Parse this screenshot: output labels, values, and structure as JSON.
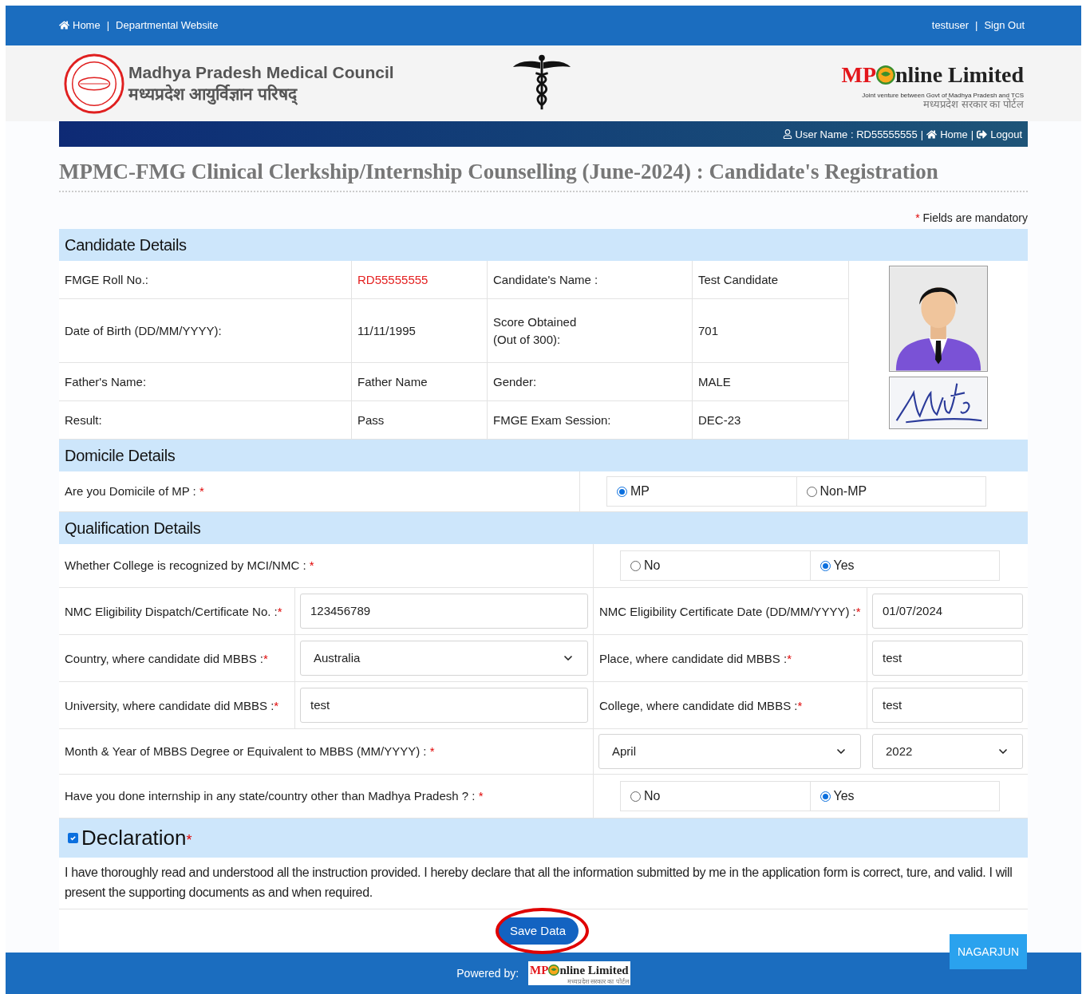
{
  "top_bar": {
    "links": [
      {
        "label": "Home"
      },
      {
        "label": "Departmental Website"
      }
    ],
    "separator": "|",
    "user": "testuser",
    "sign_out": "Sign Out"
  },
  "header": {
    "council_name": "Madhya Pradesh Medical Council",
    "council_name_hindi": "मध्यप्रदेश आयुर्विज्ञान परिषद्",
    "brand_left": "MP",
    "brand_right": "nline Limited",
    "brand_tagline": "Joint venture between Govt of Madhya Pradesh and TCS",
    "brand_hindi": "मध्यप्रदेश सरकार का पोर्टल"
  },
  "user_bar": {
    "user_name": "User Name : RD55555555",
    "separator": "|",
    "home": "Home",
    "logout": "Logout"
  },
  "title": "MPMC-FMG Clinical Clerkship/Internship Counselling (June-2024) : Candidate's Registration",
  "mandatory_note": {
    "mark": "*",
    "text": "Fields are mandatory"
  },
  "candidate": {
    "heading": "Candidate Details",
    "rows": [
      {
        "cells": [
          {
            "text": "FMGE Roll No.:",
            "kind": "label"
          },
          {
            "text": "RD55555555",
            "kind": "id"
          },
          {
            "text": "Candidate's Name :",
            "kind": "label"
          },
          {
            "text": "Test Candidate",
            "kind": "value"
          }
        ]
      },
      {
        "cells": [
          {
            "text": "Date of Birth (DD/MM/YYYY):",
            "kind": "label"
          },
          {
            "text": "11/11/1995",
            "kind": "value"
          },
          {
            "text": "Score Obtained\n(Out of 300):",
            "kind": "label"
          },
          {
            "text": "701",
            "kind": "value"
          }
        ]
      },
      {
        "cells": [
          {
            "text": "Father's Name:",
            "kind": "label"
          },
          {
            "text": "Father Name",
            "kind": "value"
          },
          {
            "text": "Gender:",
            "kind": "label"
          },
          {
            "text": "MALE",
            "kind": "value"
          }
        ]
      },
      {
        "cells": [
          {
            "text": "Result:",
            "kind": "label"
          },
          {
            "text": "Pass",
            "kind": "value"
          },
          {
            "text": "FMGE Exam Session:",
            "kind": "label"
          },
          {
            "text": "DEC-23",
            "kind": "value"
          }
        ]
      }
    ]
  },
  "domicile": {
    "heading": "Domicile Details",
    "question": "Are you Domicile of MP :",
    "required_mark": "*",
    "options": [
      {
        "label": "MP",
        "selected": true
      },
      {
        "label": "Non-MP",
        "selected": false
      }
    ]
  },
  "qualification": {
    "heading": "Qualification Details",
    "rows": [
      {
        "kind": "radio",
        "question": "Whether College is recognized by MCI/NMC :",
        "required_mark": "*",
        "options": [
          {
            "label": "No",
            "selected": false
          },
          {
            "label": "Yes",
            "selected": true
          }
        ]
      },
      {
        "kind": "fields",
        "fields": [
          {
            "label": "NMC Eligibility Dispatch/Certificate No. :",
            "required_mark": "*",
            "kind": "input",
            "value": "123456789"
          },
          {
            "label": "NMC Eligibility Certificate Date (DD/MM/YYYY) :",
            "required_mark": "*",
            "kind": "input",
            "value": "01/07/2024"
          }
        ]
      },
      {
        "kind": "fields",
        "fields": [
          {
            "label": "Country, where candidate did MBBS :",
            "required_mark": "*",
            "kind": "select",
            "value": "Australia"
          },
          {
            "label": "Place, where candidate did MBBS :",
            "required_mark": "*",
            "kind": "input",
            "value": "test"
          }
        ]
      },
      {
        "kind": "fields",
        "fields": [
          {
            "label": "University, where candidate did MBBS :",
            "required_mark": "*",
            "kind": "input",
            "value": "test"
          },
          {
            "label": "College, where candidate did MBBS :",
            "required_mark": "*",
            "kind": "input",
            "value": "test"
          }
        ]
      },
      {
        "kind": "month_year",
        "question": "Month & Year of MBBS Degree or Equivalent to MBBS (MM/YYYY) :",
        "required_mark": "*",
        "month": "April",
        "year": "2022"
      },
      {
        "kind": "radio",
        "question": "Have you done internship in any state/country other than Madhya Pradesh ? :",
        "required_mark": "*",
        "options": [
          {
            "label": "No",
            "selected": false
          },
          {
            "label": "Yes",
            "selected": true
          }
        ]
      }
    ]
  },
  "declaration": {
    "heading": "Declaration",
    "checked": true,
    "required_mark": "*",
    "text": "I have thoroughly read and understood all the instruction provided. I hereby declare that all the information submitted by me in the application form is correct, ture, and valid. I will present the supporting documents as and when required."
  },
  "save_button": {
    "label": "Save Data",
    "circled": true
  },
  "side_button": "NAGARJUN",
  "footer": {
    "powered_by": "Powered by:",
    "brand_left": "MP",
    "brand_right": "nline Limited",
    "brand_hindi": "मध्यप्रदेश सरकार का पोर्टल"
  }
}
